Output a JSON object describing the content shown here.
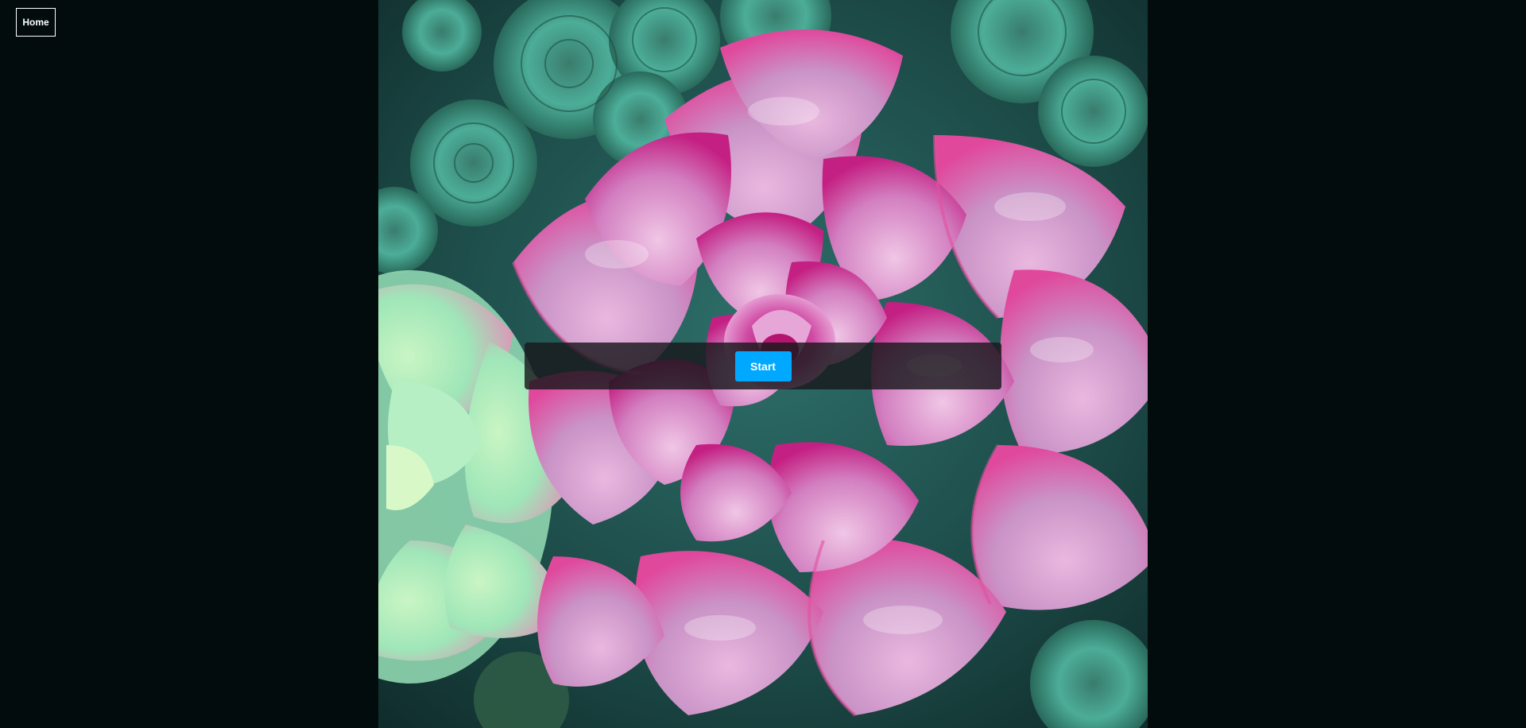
{
  "nav": {
    "home_label": "Home"
  },
  "puzzle": {
    "image_subject": "succulent-photo",
    "start_label": "Start"
  },
  "colors": {
    "page_background": "#020c0c",
    "start_button": "#00a8ff",
    "overlay_bar": "#19191c"
  }
}
